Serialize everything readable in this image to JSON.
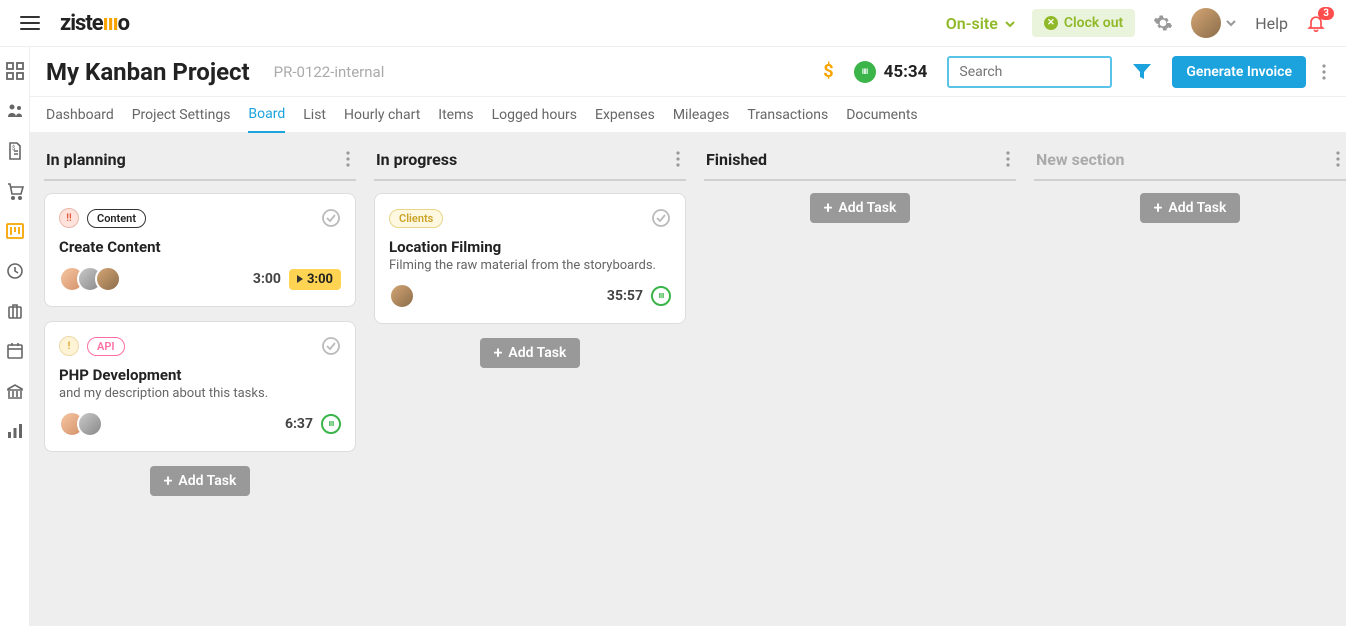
{
  "header": {
    "onsite_label": "On-site",
    "clock_out_label": "Clock out",
    "help_label": "Help",
    "notif_count": "3",
    "logo_text_1": "ziste",
    "logo_bars": "ııı",
    "logo_text_2": "o"
  },
  "subheader": {
    "title": "My Kanban Project",
    "code": "PR-0122-internal",
    "timer": "45:34",
    "search_placeholder": "Search",
    "invoice_label": "Generate Invoice"
  },
  "tabs": [
    "Dashboard",
    "Project Settings",
    "Board",
    "List",
    "Hourly chart",
    "Items",
    "Logged hours",
    "Expenses",
    "Mileages",
    "Transactions",
    "Documents"
  ],
  "active_tab": "Board",
  "columns": [
    {
      "title": "In planning",
      "muted": false,
      "cards": [
        {
          "priority": "red",
          "priority_glyph": "!!",
          "tag": "Content",
          "tag_class": "tag-content",
          "title": "Create Content",
          "desc": "",
          "avatars": [
            "av1",
            "av2",
            "av3"
          ],
          "time": "3:00",
          "time_box": "3:00",
          "sound": false
        },
        {
          "priority": "yellow",
          "priority_glyph": "!",
          "tag": "API",
          "tag_class": "tag-api",
          "title": "PHP Development",
          "desc": "and my description about this tasks.",
          "avatars": [
            "av1",
            "av2"
          ],
          "time": "6:37",
          "time_box": "",
          "sound": true
        }
      ]
    },
    {
      "title": "In progress",
      "muted": false,
      "cards": [
        {
          "priority": "",
          "priority_glyph": "",
          "tag": "Clients",
          "tag_class": "tag-clients",
          "title": "Location Filming",
          "desc": "Filming the raw material from the storyboards.",
          "avatars": [
            "av3"
          ],
          "time": "35:57",
          "time_box": "",
          "sound": true
        }
      ]
    },
    {
      "title": "Finished",
      "muted": false,
      "cards": []
    },
    {
      "title": "New section",
      "muted": true,
      "cards": []
    }
  ],
  "add_task_label": "Add Task"
}
